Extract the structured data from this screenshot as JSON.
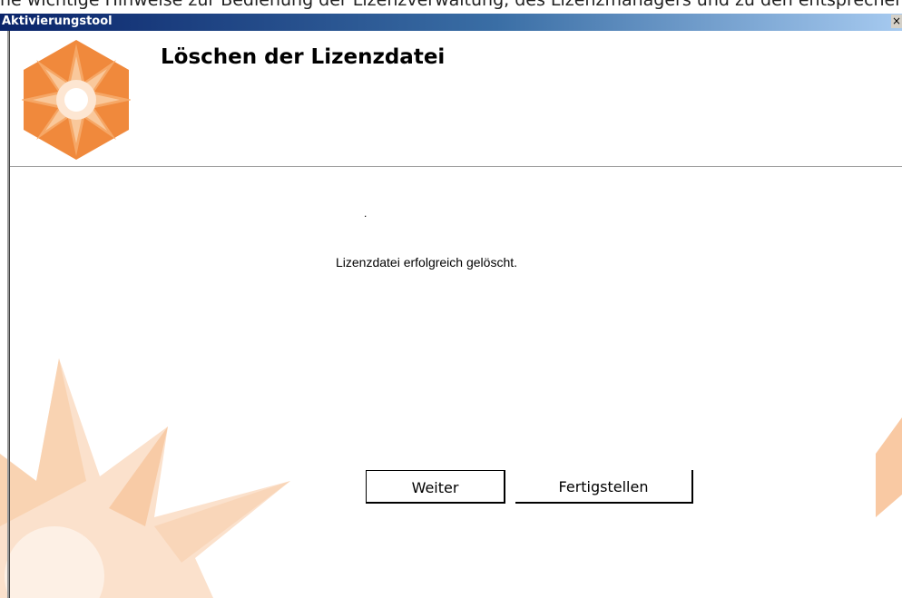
{
  "window": {
    "title": "Aktivierungstool",
    "close_glyph": "×",
    "title_gradient": [
      "#0a246a",
      "#a6caf0"
    ]
  },
  "top_text_partial": "ne wichtige Hinweise zur Bedienung der Lizenzverwaltung, des Lizenzmanagers und zu den entsprechenden Einstellungen",
  "header": {
    "heading": "Löschen der Lizenzdatei",
    "logo_icon": "orange-hexagon-star-logo-icon"
  },
  "content": {
    "dot": ".",
    "message": "Lizenzdatei erfolgreich gelöscht."
  },
  "buttons": {
    "next_label": "Weiter",
    "finish_label": "Fertigstellen"
  },
  "colors": {
    "accent_orange": "#f0893c",
    "light_orange": "#fbd3b4"
  }
}
